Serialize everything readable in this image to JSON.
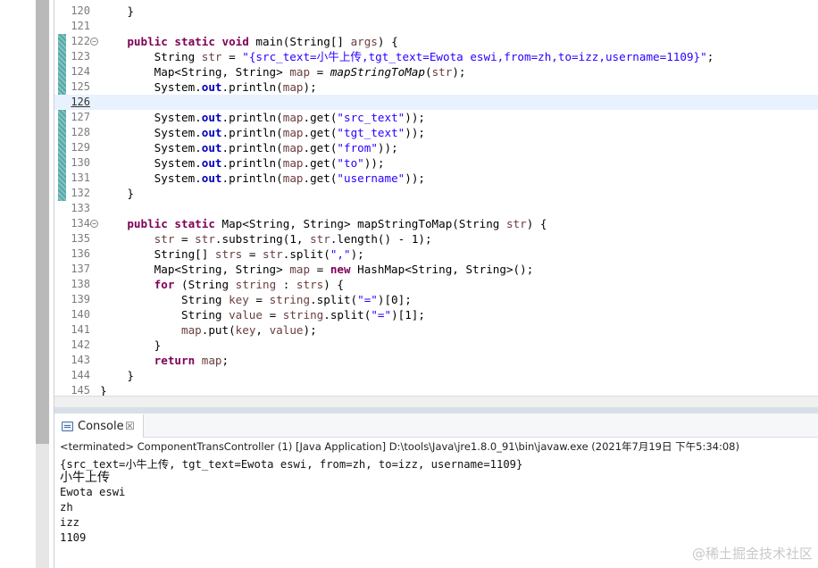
{
  "editor": {
    "lines": [
      {
        "num": "120",
        "tokens": [
          {
            "t": "    }",
            "c": ""
          }
        ]
      },
      {
        "num": "121",
        "tokens": []
      },
      {
        "num": "122",
        "fold": "−",
        "tokens": [
          {
            "t": "    ",
            "c": ""
          },
          {
            "t": "public static void",
            "c": "kw"
          },
          {
            "t": " main(String[] ",
            "c": ""
          },
          {
            "t": "args",
            "c": "ident"
          },
          {
            "t": ") {",
            "c": ""
          }
        ]
      },
      {
        "num": "123",
        "tokens": [
          {
            "t": "        String ",
            "c": ""
          },
          {
            "t": "str",
            "c": "ident"
          },
          {
            "t": " = ",
            "c": ""
          },
          {
            "t": "\"{src_text=小牛上传,tgt_text=Ewota eswi,from=zh,to=izz,username=1109}\"",
            "c": "str"
          },
          {
            "t": ";",
            "c": ""
          }
        ]
      },
      {
        "num": "124",
        "tokens": [
          {
            "t": "        Map<String, String> ",
            "c": ""
          },
          {
            "t": "map",
            "c": "ident"
          },
          {
            "t": " = ",
            "c": ""
          },
          {
            "t": "mapStringToMap",
            "c": "ital"
          },
          {
            "t": "(",
            "c": ""
          },
          {
            "t": "str",
            "c": "ident"
          },
          {
            "t": ");",
            "c": ""
          }
        ]
      },
      {
        "num": "125",
        "tokens": [
          {
            "t": "        System.",
            "c": ""
          },
          {
            "t": "out",
            "c": "fld"
          },
          {
            "t": ".println(",
            "c": ""
          },
          {
            "t": "map",
            "c": "ident"
          },
          {
            "t": ");",
            "c": ""
          }
        ]
      },
      {
        "num": "126",
        "current": true,
        "tokens": []
      },
      {
        "num": "127",
        "tokens": [
          {
            "t": "        System.",
            "c": ""
          },
          {
            "t": "out",
            "c": "fld"
          },
          {
            "t": ".println(",
            "c": ""
          },
          {
            "t": "map",
            "c": "ident"
          },
          {
            "t": ".get(",
            "c": ""
          },
          {
            "t": "\"src_text\"",
            "c": "str"
          },
          {
            "t": "));",
            "c": ""
          }
        ]
      },
      {
        "num": "128",
        "tokens": [
          {
            "t": "        System.",
            "c": ""
          },
          {
            "t": "out",
            "c": "fld"
          },
          {
            "t": ".println(",
            "c": ""
          },
          {
            "t": "map",
            "c": "ident"
          },
          {
            "t": ".get(",
            "c": ""
          },
          {
            "t": "\"tgt_text\"",
            "c": "str"
          },
          {
            "t": "));",
            "c": ""
          }
        ]
      },
      {
        "num": "129",
        "tokens": [
          {
            "t": "        System.",
            "c": ""
          },
          {
            "t": "out",
            "c": "fld"
          },
          {
            "t": ".println(",
            "c": ""
          },
          {
            "t": "map",
            "c": "ident"
          },
          {
            "t": ".get(",
            "c": ""
          },
          {
            "t": "\"from\"",
            "c": "str"
          },
          {
            "t": "));",
            "c": ""
          }
        ]
      },
      {
        "num": "130",
        "tokens": [
          {
            "t": "        System.",
            "c": ""
          },
          {
            "t": "out",
            "c": "fld"
          },
          {
            "t": ".println(",
            "c": ""
          },
          {
            "t": "map",
            "c": "ident"
          },
          {
            "t": ".get(",
            "c": ""
          },
          {
            "t": "\"to\"",
            "c": "str"
          },
          {
            "t": "));",
            "c": ""
          }
        ]
      },
      {
        "num": "131",
        "tokens": [
          {
            "t": "        System.",
            "c": ""
          },
          {
            "t": "out",
            "c": "fld"
          },
          {
            "t": ".println(",
            "c": ""
          },
          {
            "t": "map",
            "c": "ident"
          },
          {
            "t": ".get(",
            "c": ""
          },
          {
            "t": "\"username\"",
            "c": "str"
          },
          {
            "t": "));",
            "c": ""
          }
        ]
      },
      {
        "num": "132",
        "tokens": [
          {
            "t": "    }",
            "c": ""
          }
        ]
      },
      {
        "num": "133",
        "tokens": []
      },
      {
        "num": "134",
        "fold": "−",
        "tokens": [
          {
            "t": "    ",
            "c": ""
          },
          {
            "t": "public static",
            "c": "kw"
          },
          {
            "t": " Map<String, String> mapStringToMap(String ",
            "c": ""
          },
          {
            "t": "str",
            "c": "ident"
          },
          {
            "t": ") {",
            "c": ""
          }
        ]
      },
      {
        "num": "135",
        "tokens": [
          {
            "t": "        ",
            "c": ""
          },
          {
            "t": "str",
            "c": "ident"
          },
          {
            "t": " = ",
            "c": ""
          },
          {
            "t": "str",
            "c": "ident"
          },
          {
            "t": ".substring(1, ",
            "c": ""
          },
          {
            "t": "str",
            "c": "ident"
          },
          {
            "t": ".length() - 1);",
            "c": ""
          }
        ]
      },
      {
        "num": "136",
        "tokens": [
          {
            "t": "        String[] ",
            "c": ""
          },
          {
            "t": "strs",
            "c": "ident"
          },
          {
            "t": " = ",
            "c": ""
          },
          {
            "t": "str",
            "c": "ident"
          },
          {
            "t": ".split(",
            "c": ""
          },
          {
            "t": "\",\"",
            "c": "str"
          },
          {
            "t": ");",
            "c": ""
          }
        ]
      },
      {
        "num": "137",
        "tokens": [
          {
            "t": "        Map<String, String> ",
            "c": ""
          },
          {
            "t": "map",
            "c": "ident"
          },
          {
            "t": " = ",
            "c": ""
          },
          {
            "t": "new",
            "c": "kw"
          },
          {
            "t": " HashMap<String, String>();",
            "c": ""
          }
        ]
      },
      {
        "num": "138",
        "tokens": [
          {
            "t": "        ",
            "c": ""
          },
          {
            "t": "for",
            "c": "kw"
          },
          {
            "t": " (String ",
            "c": ""
          },
          {
            "t": "string",
            "c": "ident"
          },
          {
            "t": " : ",
            "c": ""
          },
          {
            "t": "strs",
            "c": "ident"
          },
          {
            "t": ") {",
            "c": ""
          }
        ]
      },
      {
        "num": "139",
        "tokens": [
          {
            "t": "            String ",
            "c": ""
          },
          {
            "t": "key",
            "c": "ident"
          },
          {
            "t": " = ",
            "c": ""
          },
          {
            "t": "string",
            "c": "ident"
          },
          {
            "t": ".split(",
            "c": ""
          },
          {
            "t": "\"=\"",
            "c": "str"
          },
          {
            "t": ")[0];",
            "c": ""
          }
        ]
      },
      {
        "num": "140",
        "tokens": [
          {
            "t": "            String ",
            "c": ""
          },
          {
            "t": "value",
            "c": "ident"
          },
          {
            "t": " = ",
            "c": ""
          },
          {
            "t": "string",
            "c": "ident"
          },
          {
            "t": ".split(",
            "c": ""
          },
          {
            "t": "\"=\"",
            "c": "str"
          },
          {
            "t": ")[1];",
            "c": ""
          }
        ]
      },
      {
        "num": "141",
        "tokens": [
          {
            "t": "            ",
            "c": ""
          },
          {
            "t": "map",
            "c": "ident"
          },
          {
            "t": ".put(",
            "c": ""
          },
          {
            "t": "key",
            "c": "ident"
          },
          {
            "t": ", ",
            "c": ""
          },
          {
            "t": "value",
            "c": "ident"
          },
          {
            "t": ");",
            "c": ""
          }
        ]
      },
      {
        "num": "142",
        "tokens": [
          {
            "t": "        }",
            "c": ""
          }
        ]
      },
      {
        "num": "143",
        "tokens": [
          {
            "t": "        ",
            "c": ""
          },
          {
            "t": "return",
            "c": "kw"
          },
          {
            "t": " ",
            "c": ""
          },
          {
            "t": "map",
            "c": "ident"
          },
          {
            "t": ";",
            "c": ""
          }
        ]
      },
      {
        "num": "144",
        "tokens": [
          {
            "t": "    }",
            "c": ""
          }
        ]
      },
      {
        "num": "145",
        "tokens": [
          {
            "t": "}",
            "c": ""
          }
        ]
      }
    ]
  },
  "console": {
    "tab_label": "Console",
    "close_glyph": "☒",
    "terminated_text": "<terminated> ComponentTransController (1) [Java Application] D:\\tools\\Java\\jre1.8.0_91\\bin\\javaw.exe (2021年7月19日 下午5:34:08)",
    "output": [
      "{src_text=小牛上传, tgt_text=Ewota eswi, from=zh, to=izz, username=1109}",
      "小牛上传",
      "Ewota eswi",
      "zh",
      "izz",
      "1109"
    ]
  },
  "watermark": "@稀土掘金技术社区",
  "colors": {
    "keyword": "#7f0055",
    "string": "#2a00ff",
    "field": "#0000c0",
    "current_line": "#e8f2fe",
    "change_bar": "#7fc5c2"
  }
}
